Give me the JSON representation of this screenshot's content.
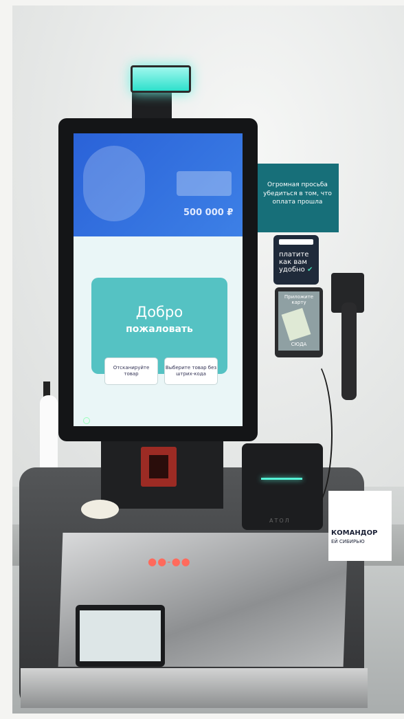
{
  "kiosk": {
    "welcome_title": "Добро",
    "welcome_subtitle": "пожаловать",
    "scan_button_label": "Отсканируйте товар",
    "no_barcode_button_label": "Выберите товар без штрих-кода",
    "banner_prize": "500 000 ₽"
  },
  "wall_sign": {
    "text": "Огромная просьба убедиться в том, что оплата прошла"
  },
  "terminal": {
    "top_message": "платите как вам удобно",
    "screen_prompt": "Приложите карту",
    "screen_bottom": "СЮДА"
  },
  "printer": {
    "brand": "АТОЛ"
  },
  "box": {
    "label": "КОМАНДОР",
    "sub": "ЕЙ СИБИРЬЮ"
  },
  "colors": {
    "accent_teal": "#55c2c3",
    "lamp_glow": "#2ee0cc",
    "sign_teal": "#176f79",
    "banner_blue": "#2a62d8"
  }
}
